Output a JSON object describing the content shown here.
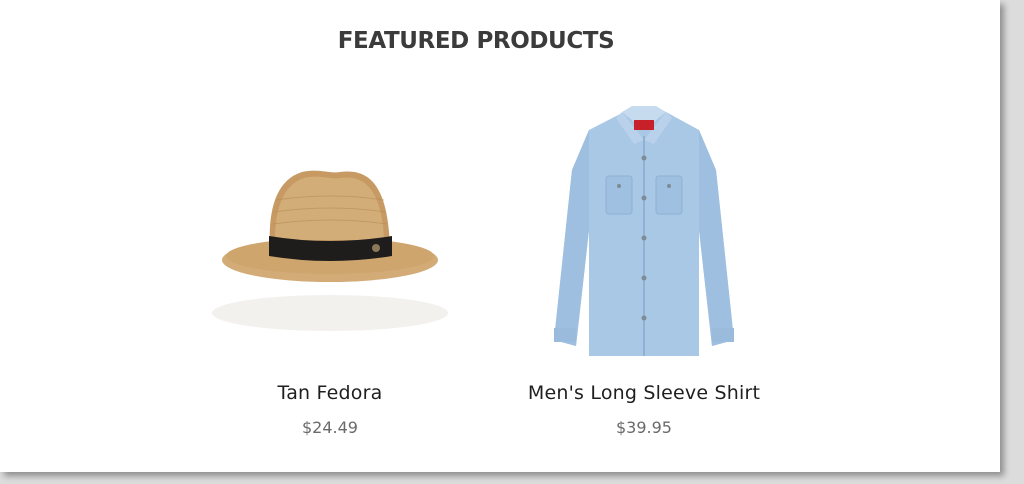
{
  "section": {
    "title": "FEATURED PRODUCTS"
  },
  "products": [
    {
      "name": "Tan Fedora",
      "price": "$24.49",
      "image_icon": "fedora-hat-icon",
      "colors": {
        "straw": "#cfa56e",
        "band": "#1f1d1b"
      }
    },
    {
      "name": "Men's Long Sleeve Shirt",
      "price": "$39.95",
      "image_icon": "long-sleeve-shirt-icon",
      "colors": {
        "fabric": "#a9c8e6",
        "accent": "#c8202a"
      }
    }
  ]
}
